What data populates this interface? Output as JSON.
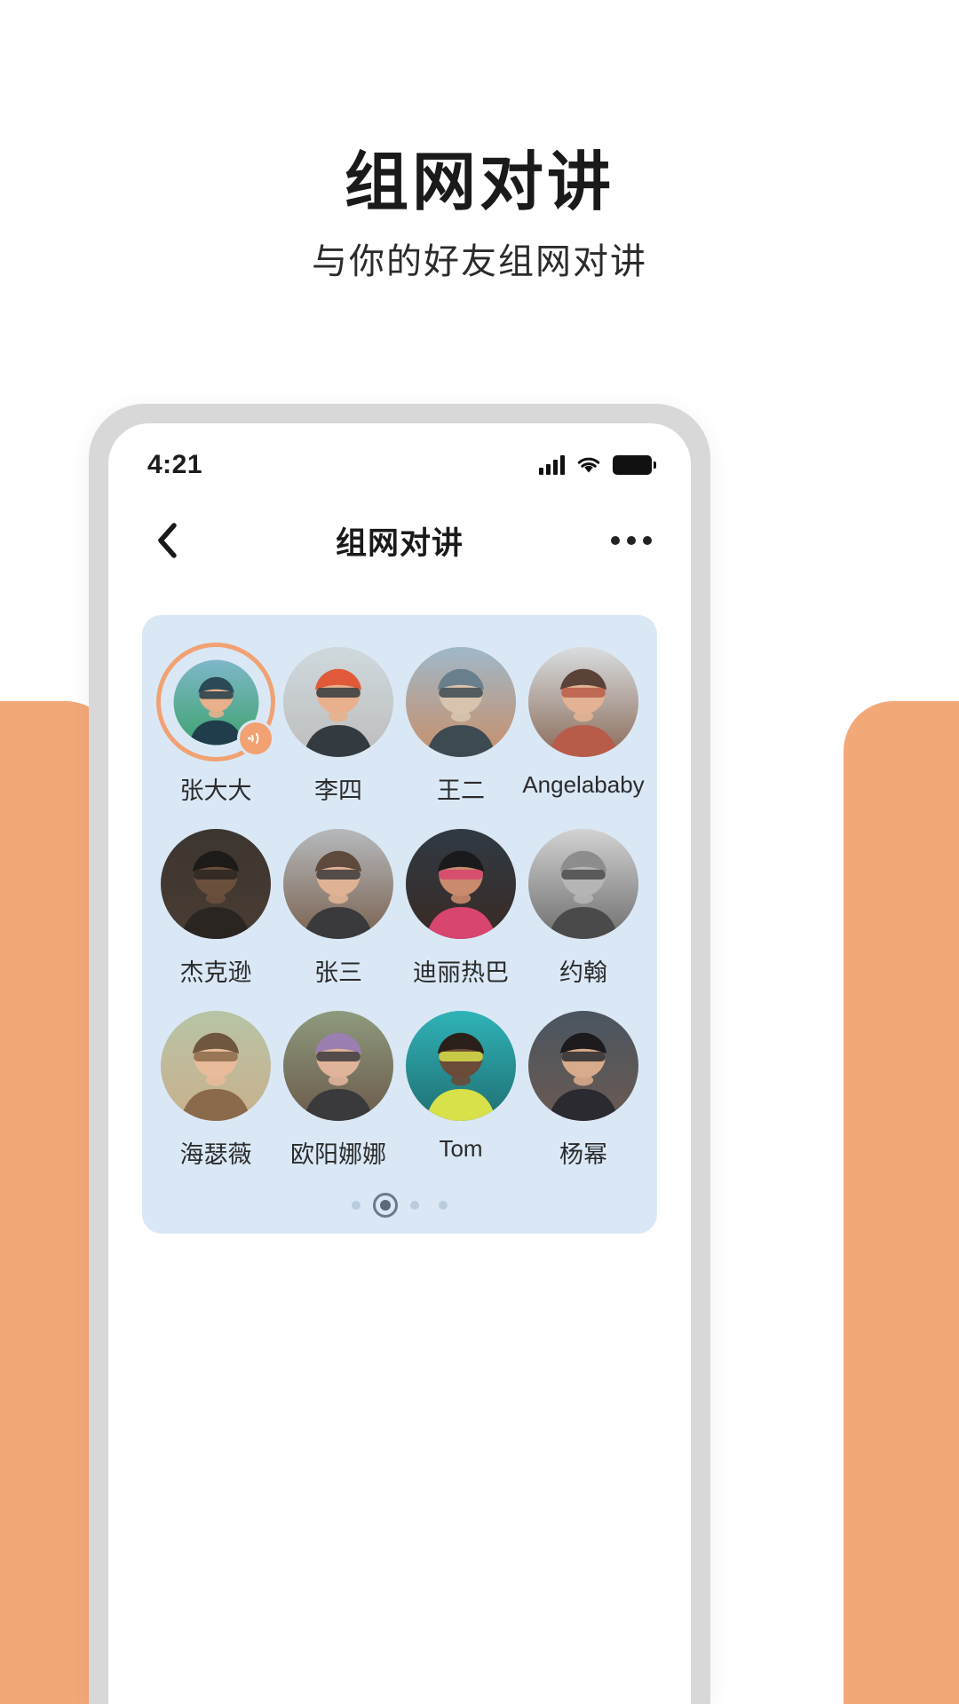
{
  "hero": {
    "title": "组网对讲",
    "subtitle": "与你的好友组网对讲"
  },
  "colors": {
    "accent_orange": "#f3a878",
    "card_blue": "#dae8f6",
    "phone_frame": "#d8d8d8",
    "text_dark": "#1a1a1a",
    "dot_active": "#6b7a88",
    "dot_inactive": "#b9cbdd"
  },
  "phone": {
    "status_bar": {
      "time": "4:21",
      "icons": [
        "cellular-signal-icon",
        "wifi-icon",
        "battery-icon"
      ]
    },
    "navbar": {
      "back_icon": "chevron-left-icon",
      "title": "组网对讲",
      "more_icon": "more-horizontal-icon"
    },
    "contacts": [
      {
        "name": "张大大",
        "active": true,
        "badge": "voice-talk-icon",
        "avatar": "man-sunglasses-green"
      },
      {
        "name": "李四",
        "active": false,
        "avatar": "man-red-cap"
      },
      {
        "name": "王二",
        "active": false,
        "avatar": "group-outdoor"
      },
      {
        "name": "Angelababy",
        "active": false,
        "avatar": "woman-phone-call"
      },
      {
        "name": "杰克逊",
        "active": false,
        "avatar": "man-dark-portrait"
      },
      {
        "name": "张三",
        "active": false,
        "avatar": "man-glasses-beard"
      },
      {
        "name": "迪丽热巴",
        "active": false,
        "avatar": "woman-sunglasses-pink"
      },
      {
        "name": "约翰",
        "active": false,
        "avatar": "man-hat-bw"
      },
      {
        "name": "海瑟薇",
        "active": false,
        "avatar": "woman-smiling-outdoor"
      },
      {
        "name": "欧阳娜娜",
        "active": false,
        "avatar": "woman-purple-hair-glasses"
      },
      {
        "name": "Tom",
        "active": false,
        "avatar": "man-teal-background"
      },
      {
        "name": "杨幂",
        "active": false,
        "avatar": "woman-dark-hair-portrait"
      }
    ],
    "pagination": {
      "total": 4,
      "current_index": 1
    }
  }
}
